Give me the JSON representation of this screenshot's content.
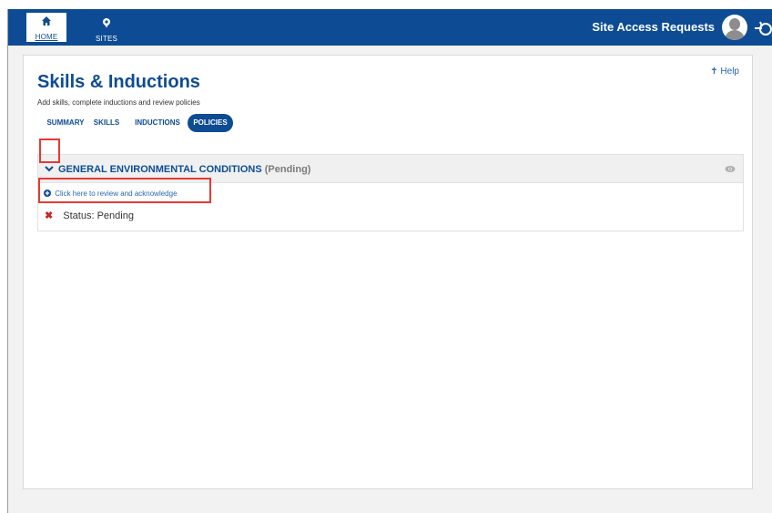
{
  "topbar": {
    "nav": [
      {
        "label": "HOME",
        "icon": "home-icon"
      },
      {
        "label": "SITES",
        "icon": "location-pin-icon"
      }
    ],
    "site_access_label": "Site Access Requests",
    "avatar": "avatar-icon",
    "logo": "brand-logo-icon"
  },
  "page": {
    "help_label": "Help",
    "help_icon": "pin-icon",
    "title": "Skills & Inductions",
    "subtitle": "Add skills, complete inductions and review policies"
  },
  "tabs": [
    {
      "label": "SUMMARY",
      "active": false
    },
    {
      "label": "SKILLS",
      "active": false
    },
    {
      "label": "INDUCTIONS",
      "active": false
    },
    {
      "label": "POLICIES",
      "active": true
    }
  ],
  "policy": {
    "title": "GENERAL ENVIRONMENTAL CONDITIONS",
    "status_suffix": "(Pending)",
    "review_link": "Click here to review and acknowledge",
    "status_text": "Status: Pending",
    "status_mark": "✖"
  },
  "colors": {
    "brand": "#0d4c94",
    "link": "#2a66b0",
    "highlight": "#e53935",
    "error": "#c62828"
  }
}
